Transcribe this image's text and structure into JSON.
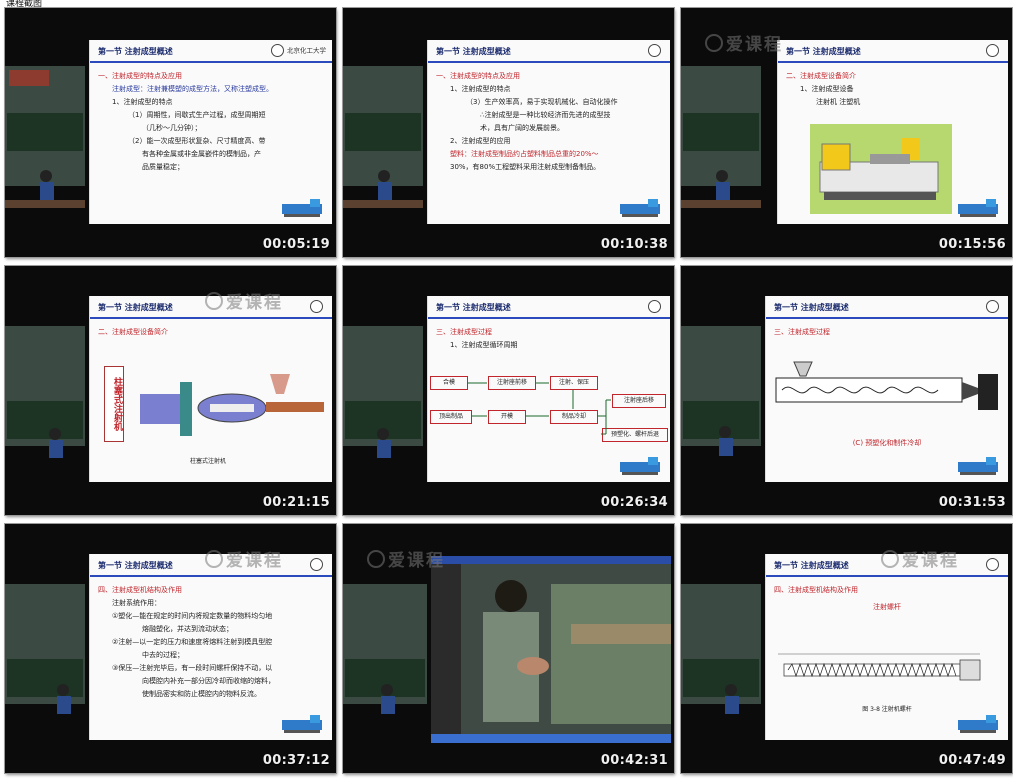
{
  "page": {
    "header_text": "课程截图"
  },
  "common": {
    "section_title": "第一节 注射成型概述",
    "university": "北京化工大学",
    "watermark": "爱课程"
  },
  "tiles": [
    {
      "timestamp": "00:05:19",
      "lines": [
        "一、注射成型的特点及应用",
        "注射成型：注射兼模塑的成型方法，又称注塑成型。",
        "1、注射成型的特点",
        "（1）周期性，间歇式生产过程，成型周期短",
        "（几秒～几分钟）；",
        "（2）能一次成型形状复杂、尺寸精度高、带",
        "有各种金属或非金属嵌件的模制品，产",
        "品质量稳定；"
      ]
    },
    {
      "timestamp": "00:10:38",
      "lines": [
        "一、注射成型的特点及应用",
        "1、注射成型的特点",
        "（3）生产效率高，易于实现机械化、自动化操作",
        "∴注射成型是一种比较经济而先进的成型技",
        "术，具有广阔的发展前景。",
        "2、注射成型的应用",
        "塑料：注射成型制品约占塑料制品总重的20%～",
        "30%，有80%工程塑料采用注射成型制备制品。"
      ]
    },
    {
      "timestamp": "00:15:56",
      "lines": [
        "二、注射成型设备简介",
        "1、注射成型设备",
        "注射机 注塑机"
      ]
    },
    {
      "timestamp": "00:21:15",
      "lines": [
        "二、注射成型设备简介",
        "柱塞式注射机",
        "柱塞式注射机"
      ]
    },
    {
      "timestamp": "00:26:34",
      "lines": [
        "三、注射成型过程",
        "1、注射成型循环周期"
      ],
      "flow": [
        "合模",
        "注射座前移",
        "注射、保压",
        "制品冷却",
        "开模",
        "顶出制品",
        "注射座后移",
        "预塑化、螺杆后退"
      ]
    },
    {
      "timestamp": "00:31:53",
      "lines": [
        "三、注射成型过程",
        "(C) 预塑化和制件冷却"
      ]
    },
    {
      "timestamp": "00:37:12",
      "lines": [
        "四、注射成型机结构及作用",
        "注射系统作用：",
        "①塑化—能在规定的时间内将规定数量的物料均匀地",
        "熔融塑化，并达到流动状态；",
        "②注射—以一定的压力和速度将熔料注射到模具型腔",
        "中去的过程；",
        "③保压—注射完毕后，有一段时间螺杆保持不动，以",
        "向模腔内补充一部分因冷却而收缩的熔料，",
        "使制品密实和防止模腔内的物料反流。"
      ]
    },
    {
      "timestamp": "00:42:31",
      "lines": []
    },
    {
      "timestamp": "00:47:49",
      "lines": [
        "四、注射成型机结构及作用",
        "注射螺杆",
        "图 3-8 注射机螺杆"
      ]
    }
  ]
}
